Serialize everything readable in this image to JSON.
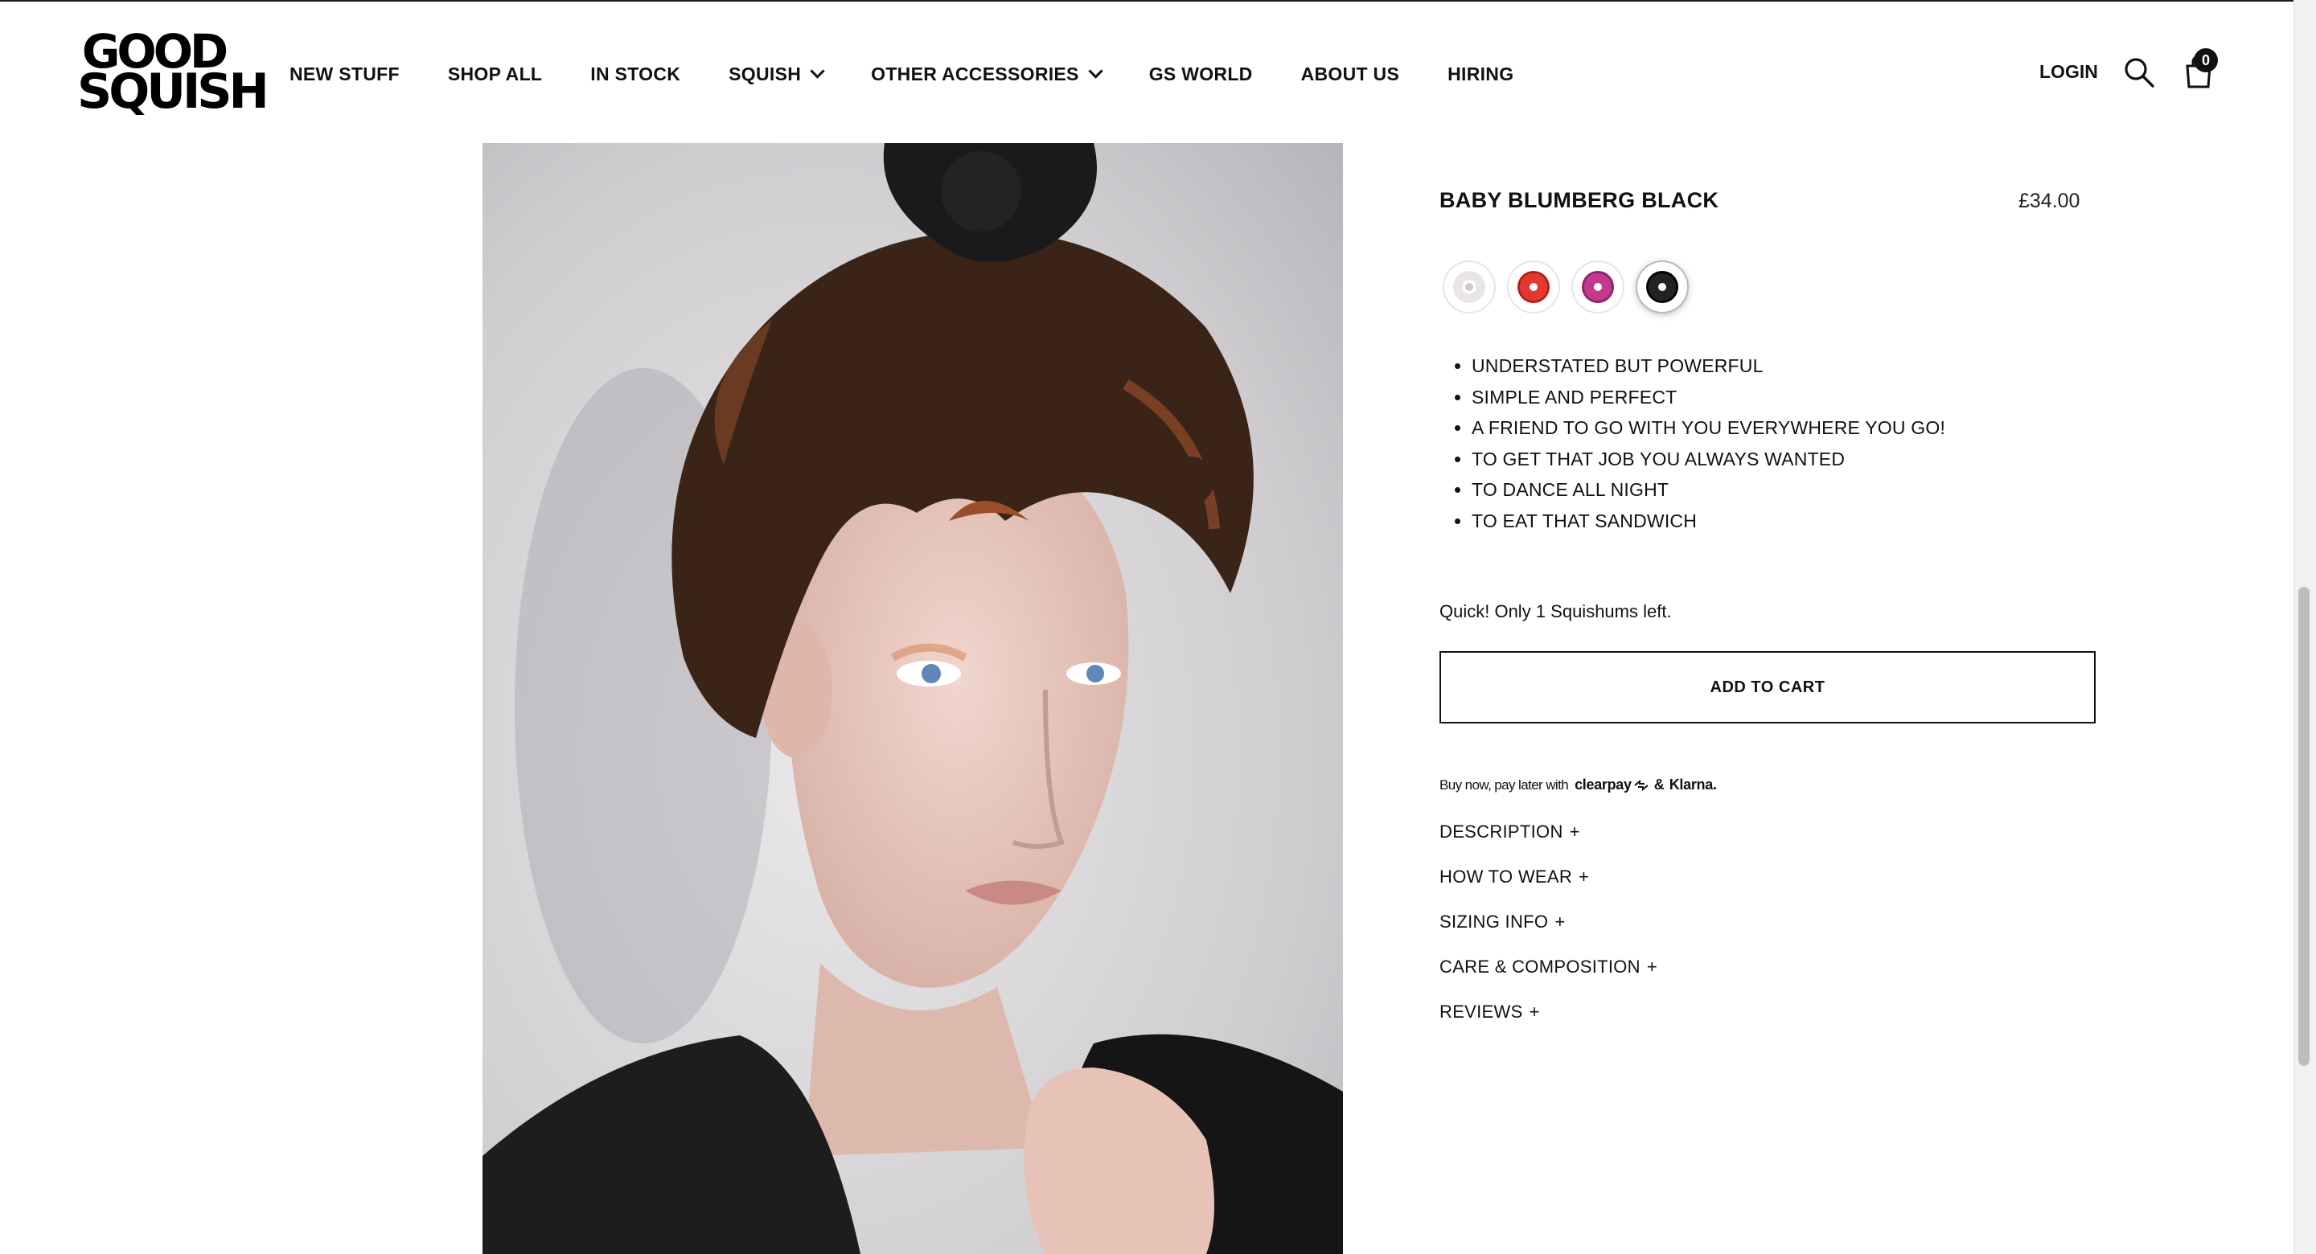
{
  "header": {
    "logo_line1": "GOOD",
    "logo_line2": "SQUISH",
    "nav": [
      {
        "label": "NEW STUFF",
        "dropdown": false
      },
      {
        "label": "SHOP ALL",
        "dropdown": false
      },
      {
        "label": "IN STOCK",
        "dropdown": false
      },
      {
        "label": "SQUISH",
        "dropdown": true
      },
      {
        "label": "OTHER ACCESSORIES",
        "dropdown": true
      },
      {
        "label": "GS WORLD",
        "dropdown": false
      },
      {
        "label": "ABOUT US",
        "dropdown": false
      },
      {
        "label": "HIRING",
        "dropdown": false
      }
    ],
    "login_label": "LOGIN",
    "cart_count": "0",
    "icons": {
      "search": "search-icon",
      "cart": "shopping-bag-icon"
    }
  },
  "product": {
    "title": "BABY BLUMBERG BLACK",
    "price": "£34.00",
    "swatches": [
      {
        "name": "white",
        "color": "#f1eeee",
        "selected": false
      },
      {
        "name": "red",
        "color": "#d42a22",
        "selected": false
      },
      {
        "name": "magenta",
        "color": "#b0247a",
        "selected": false
      },
      {
        "name": "black",
        "color": "#111111",
        "selected": true
      }
    ],
    "bullets": [
      "UNDERSTATED BUT POWERFUL",
      "SIMPLE AND PERFECT",
      "A FRIEND TO GO WITH YOU EVERYWHERE YOU GO!",
      "TO GET THAT JOB YOU ALWAYS WANTED",
      "TO DANCE ALL NIGHT",
      "TO EAT THAT SANDWICH"
    ],
    "stock_note": "Quick! Only 1 Squishums left.",
    "add_to_cart_label": "ADD TO CART",
    "paylater": {
      "text": "Buy now, pay later with",
      "provider1": "clearpay",
      "amp": "&",
      "provider2": "Klarna."
    },
    "accordion": [
      {
        "label": "DESCRIPTION",
        "icon": "+"
      },
      {
        "label": "HOW TO WEAR",
        "icon": "+"
      },
      {
        "label": "SIZING INFO",
        "icon": "+"
      },
      {
        "label": "CARE & COMPOSITION",
        "icon": "+"
      },
      {
        "label": "REVIEWS",
        "icon": "+"
      }
    ]
  },
  "colors": {
    "text": "#111111",
    "background": "#ffffff",
    "accent": "#000000"
  }
}
